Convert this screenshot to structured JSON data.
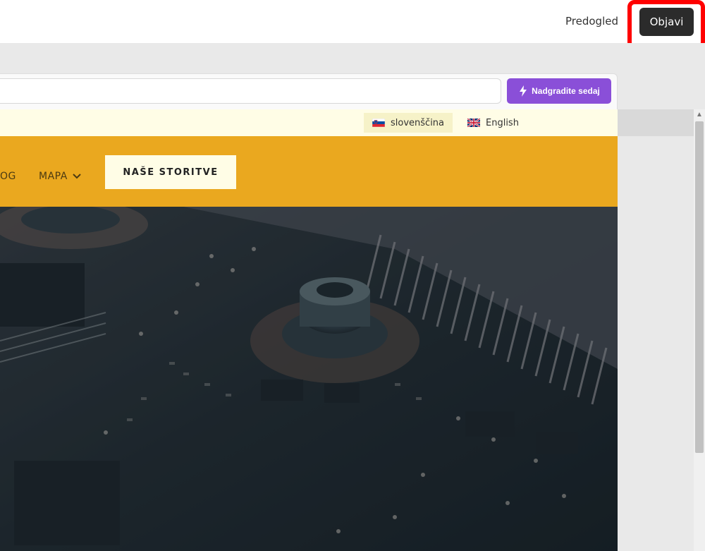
{
  "topbar": {
    "preview_label": "Predogled",
    "publish_label": "Objavi"
  },
  "toolbar": {
    "url_value": "",
    "upgrade_label": "Nadgradite sedaj"
  },
  "site": {
    "languages": [
      {
        "label": "slovenščina",
        "flag": "slovenia-flag-icon",
        "active": true
      },
      {
        "label": "English",
        "flag": "uk-flag-icon",
        "active": false
      }
    ],
    "nav": {
      "blog_partial": "OG",
      "mapa_label": "MAPA",
      "cta_label": "NAŠE STORITVE"
    }
  },
  "colors": {
    "nav_bg": "#eaa81f",
    "lang_bar_bg": "#fffde6",
    "upgrade_bg": "#8a4fd8",
    "publish_bg": "#2b2b2b",
    "highlight": "#ff0000"
  }
}
